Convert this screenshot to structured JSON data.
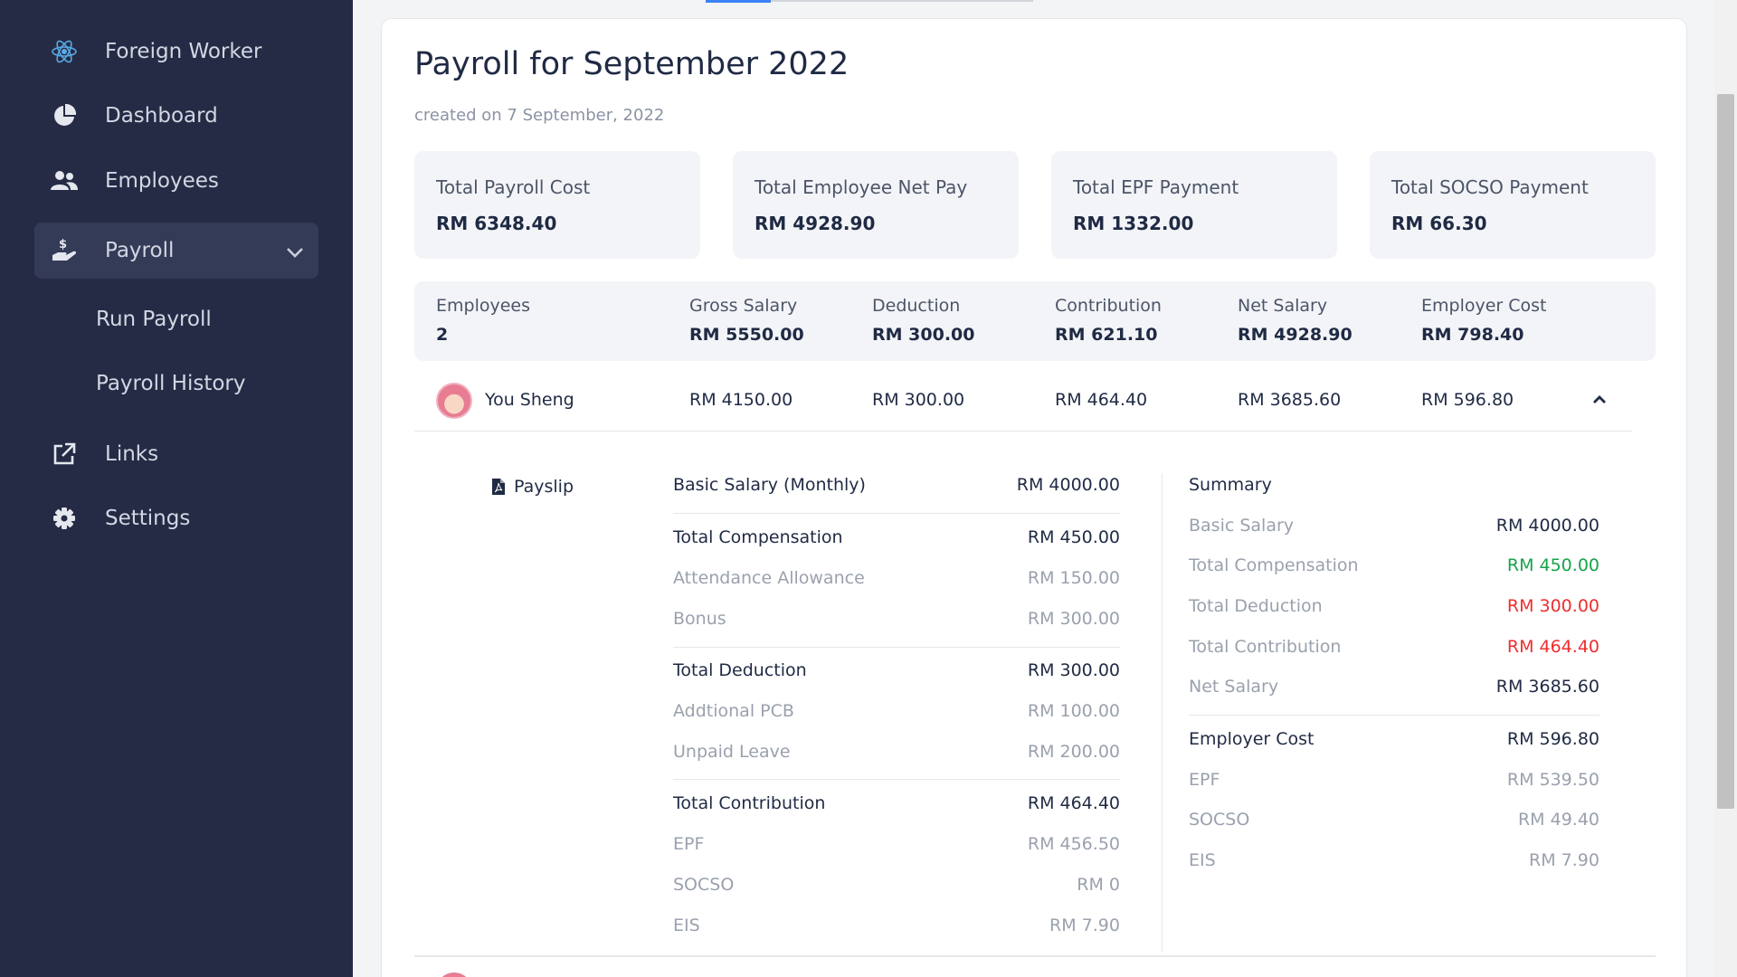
{
  "sidebar": {
    "items": [
      {
        "label": "Foreign Worker",
        "icon": "react-atom-icon"
      },
      {
        "label": "Dashboard",
        "icon": "pie-chart-icon"
      },
      {
        "label": "Employees",
        "icon": "users-icon"
      },
      {
        "label": "Payroll",
        "icon": "hand-dollar-icon"
      },
      {
        "label": "Links",
        "icon": "external-link-icon"
      },
      {
        "label": "Settings",
        "icon": "gear-icon"
      }
    ],
    "payroll_sub": [
      {
        "label": "Run Payroll"
      },
      {
        "label": "Payroll History"
      }
    ]
  },
  "page": {
    "title": "Payroll for September 2022",
    "subtitle": "created on 7 September, 2022"
  },
  "stats": [
    {
      "label": "Total Payroll Cost",
      "value": "RM 6348.40"
    },
    {
      "label": "Total Employee Net Pay",
      "value": "RM 4928.90"
    },
    {
      "label": "Total EPF Payment",
      "value": "RM 1332.00"
    },
    {
      "label": "Total SOCSO Payment",
      "value": "RM 66.30"
    }
  ],
  "summary": {
    "employees": {
      "label": "Employees",
      "value": "2"
    },
    "gross": {
      "label": "Gross Salary",
      "value": "RM 5550.00"
    },
    "deduction": {
      "label": "Deduction",
      "value": "RM 300.00"
    },
    "contribution": {
      "label": "Contribution",
      "value": "RM 621.10"
    },
    "net": {
      "label": "Net Salary",
      "value": "RM 4928.90"
    },
    "employer": {
      "label": "Employer Cost",
      "value": "RM 798.40"
    }
  },
  "employee": {
    "name": "You Sheng",
    "gross": "RM 4150.00",
    "deduction": "RM 300.00",
    "contribution": "RM 464.40",
    "net": "RM 3685.60",
    "employer": "RM 596.80"
  },
  "detail": {
    "payslip_label": "Payslip",
    "basic": {
      "label": "Basic Salary (Monthly)",
      "value": "RM 4000.00"
    },
    "compensation": {
      "label": "Total Compensation",
      "value": "RM 450.00",
      "items": [
        {
          "label": "Attendance Allowance",
          "value": "RM 150.00"
        },
        {
          "label": "Bonus",
          "value": "RM 300.00"
        }
      ]
    },
    "deduction": {
      "label": "Total Deduction",
      "value": "RM 300.00",
      "items": [
        {
          "label": "Addtional PCB",
          "value": "RM 100.00"
        },
        {
          "label": "Unpaid Leave",
          "value": "RM 200.00"
        }
      ]
    },
    "contribution": {
      "label": "Total Contribution",
      "value": "RM 464.40",
      "items": [
        {
          "label": "EPF",
          "value": "RM 456.50"
        },
        {
          "label": "SOCSO",
          "value": "RM 0"
        },
        {
          "label": "EIS",
          "value": "RM 7.90"
        }
      ]
    },
    "summary": {
      "title": "Summary",
      "rows": [
        {
          "label": "Basic Salary",
          "value": "RM 4000.00"
        },
        {
          "label": "Total Compensation",
          "value": "RM 450.00"
        },
        {
          "label": "Total Deduction",
          "value": "RM 300.00"
        },
        {
          "label": "Total Contribution",
          "value": "RM 464.40"
        },
        {
          "label": "Net Salary",
          "value": "RM 3685.60"
        }
      ],
      "employer": {
        "label": "Employer Cost",
        "value": "RM 596.80",
        "items": [
          {
            "label": "EPF",
            "value": "RM 539.50"
          },
          {
            "label": "SOCSO",
            "value": "RM 49.40"
          },
          {
            "label": "EIS",
            "value": "RM 7.90"
          }
        ]
      }
    }
  },
  "colors": {
    "sidebar_bg": "#252b45",
    "accent": "#3b82f6",
    "positive": "#16a34a",
    "negative": "#ef2d2d"
  }
}
